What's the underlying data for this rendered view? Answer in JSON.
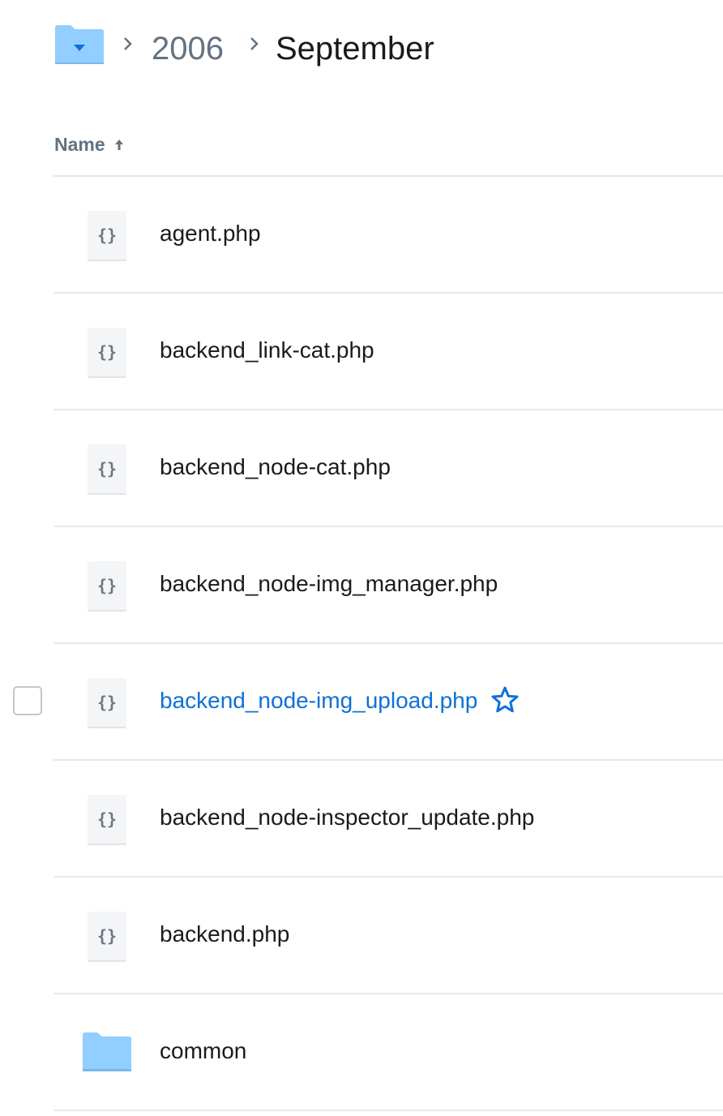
{
  "breadcrumb": {
    "root_icon": "folder-dropdown-icon",
    "items": [
      "2006",
      "September"
    ]
  },
  "columns": {
    "name_label": "Name",
    "sort_icon": "arrow-up-icon",
    "sort_direction": "ascending"
  },
  "files": [
    {
      "name": "agent.php",
      "type": "file",
      "icon": "code-file-icon"
    },
    {
      "name": "backend_link-cat.php",
      "type": "file",
      "icon": "code-file-icon"
    },
    {
      "name": "backend_node-cat.php",
      "type": "file",
      "icon": "code-file-icon"
    },
    {
      "name": "backend_node-img_manager.php",
      "type": "file",
      "icon": "code-file-icon"
    },
    {
      "name": "backend_node-img_upload.php",
      "type": "file",
      "icon": "code-file-icon",
      "hovered": true,
      "star_icon": "star-outline-icon"
    },
    {
      "name": "backend_node-inspector_update.php",
      "type": "file",
      "icon": "code-file-icon"
    },
    {
      "name": "backend.php",
      "type": "file",
      "icon": "code-file-icon"
    },
    {
      "name": "common",
      "type": "folder",
      "icon": "folder-icon"
    }
  ],
  "colors": {
    "link_blue": "#0f70d9",
    "folder_blue": "#92ceff",
    "muted_text": "#637282",
    "divider": "#e6e8eb"
  }
}
